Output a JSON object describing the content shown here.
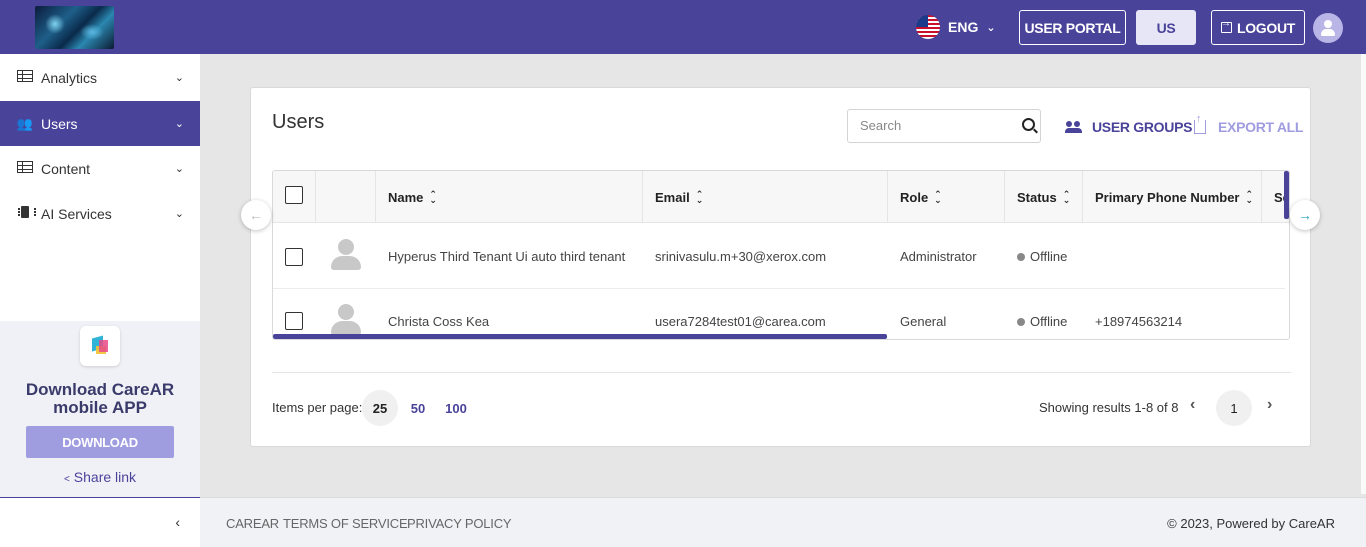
{
  "header": {
    "language": "ENG",
    "user_portal_label": "USER PORTAL",
    "region_label": "US",
    "logout_label": "LOGOUT"
  },
  "sidebar": {
    "items": [
      {
        "label": "Analytics",
        "icon": "table-icon"
      },
      {
        "label": "Users",
        "icon": "users-icon",
        "active": true
      },
      {
        "label": "Content",
        "icon": "table-icon"
      },
      {
        "label": "AI Services",
        "icon": "chip-icon"
      }
    ],
    "promo": {
      "title_line1": "Download CareAR",
      "title_line2": "mobile APP",
      "download_label": "DOWNLOAD",
      "share_label": "Share link"
    }
  },
  "main": {
    "title": "Users",
    "search_placeholder": "Search",
    "user_groups_label": "USER GROUPS",
    "export_all_label": "EXPORT ALL",
    "columns": [
      "Name",
      "Email",
      "Role",
      "Status",
      "Primary Phone Number",
      "Se"
    ],
    "rows": [
      {
        "name": "Hyperus Third Tenant Ui auto third tenant",
        "email": "srinivasulu.m+30@xerox.com",
        "role": "Administrator",
        "status": "Offline",
        "phone": ""
      },
      {
        "name": "Christa Coss Kea",
        "email": "usera7284test01@carea.com",
        "role": "General",
        "status": "Offline",
        "phone": "+18974563214"
      }
    ],
    "pagination": {
      "items_per_page_label": "Items per page:",
      "options": [
        "25",
        "50",
        "100"
      ],
      "selected": "25",
      "results_text": "Showing results 1-8 of 8",
      "current_page": "1"
    }
  },
  "footer": {
    "links": [
      "CAREAR",
      "TERMS OF SERVICE",
      "PRIVACY POLICY"
    ],
    "copyright": "© 2023, Powered by CareAR"
  },
  "colors": {
    "brand": "#4a439a",
    "brand_light": "#9f9ce0",
    "status_offline": "#888888"
  }
}
